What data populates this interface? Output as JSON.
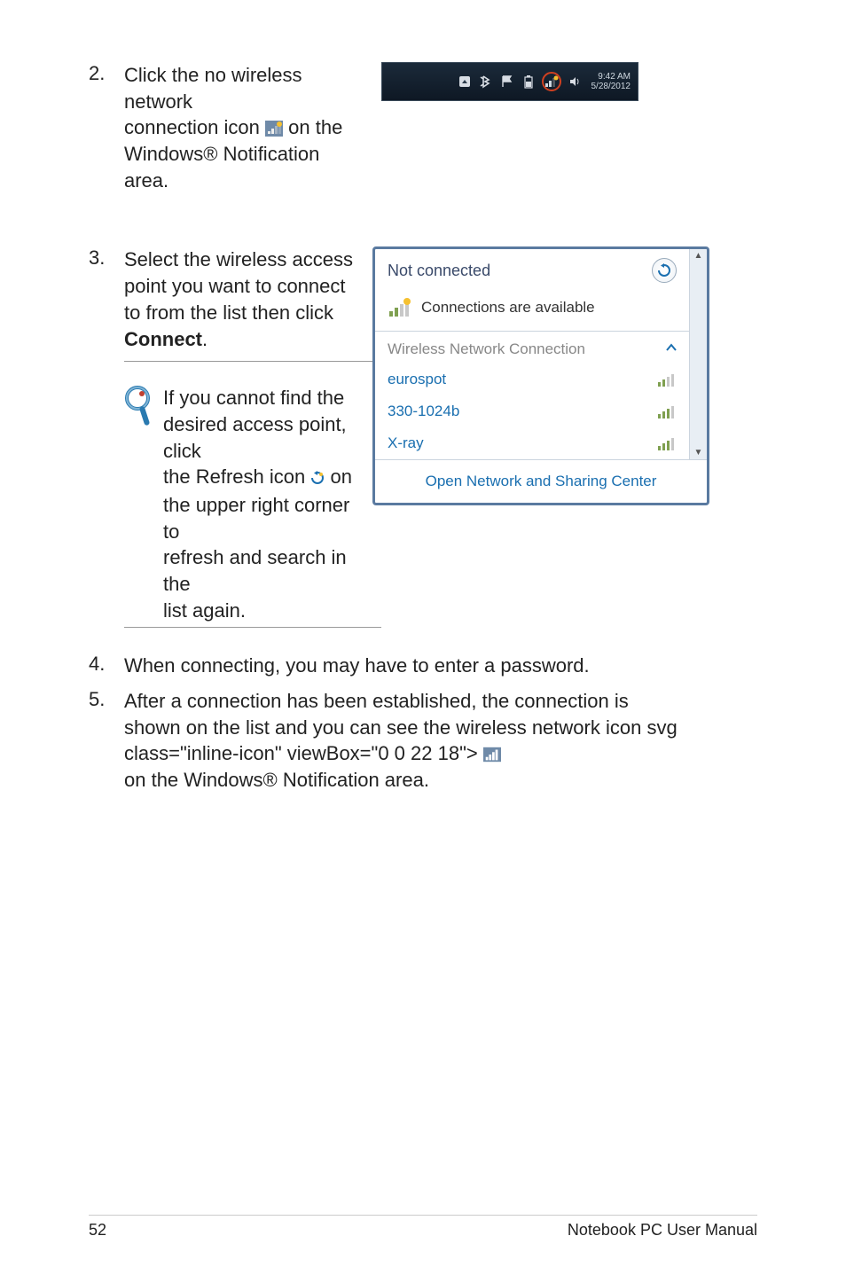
{
  "step2": {
    "num": "2.",
    "line1": "Click the no wireless network",
    "line2a": "connection icon",
    "line2b": "on the",
    "line3": "Windows® Notification area."
  },
  "taskbar": {
    "time": "9:42 AM",
    "date": "5/28/2012"
  },
  "step3": {
    "num": "3.",
    "line1": "Select the wireless access",
    "line2": "point you want to connect",
    "line3": "to from the list then click",
    "connect": "Connect",
    "period": "."
  },
  "tip": {
    "line1": "If you cannot find the",
    "line2": "desired access point, click",
    "line3a": "the",
    "refresh": "Refresh",
    "line3b": "icon",
    "line3c": "on",
    "line4": "the upper right corner to",
    "line5": "refresh and search in the",
    "line6": "list again."
  },
  "popup": {
    "not_connected": "Not connected",
    "conn_avail": "Connections are available",
    "wnc": "Wireless Network Connection",
    "networks": [
      {
        "name": "eurospot"
      },
      {
        "name": "330-1024b"
      },
      {
        "name": "X-ray"
      }
    ],
    "footer": "Open Network and Sharing Center"
  },
  "step4": {
    "num": "4.",
    "text": "When connecting, you may have to enter a password."
  },
  "step5": {
    "num": "5.",
    "line1": "After a connection has been established, the connection is",
    "line2a": "shown on the list and you can see the wireless network icon",
    "line3": "on the Windows® Notification area."
  },
  "footer": {
    "page": "52",
    "title": "Notebook PC User Manual"
  }
}
